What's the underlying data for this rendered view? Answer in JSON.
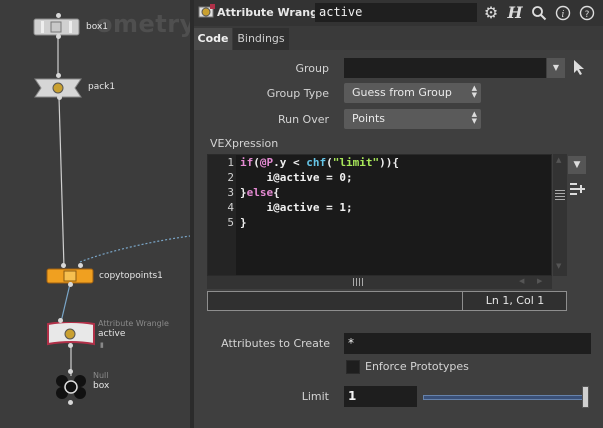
{
  "network": {
    "watermark": "ometry",
    "nodes": [
      {
        "name": "box1",
        "type": ""
      },
      {
        "name": "pack1",
        "type": ""
      },
      {
        "name": "copytopoints1",
        "type": ""
      },
      {
        "name": "active",
        "type": "Attribute Wrangle"
      },
      {
        "name": "box",
        "type": "Null"
      }
    ]
  },
  "header": {
    "node_type": "Attribute Wrangle",
    "node_name": "active",
    "icons": [
      "gear-icon",
      "help-h-icon",
      "search-icon",
      "info-icon",
      "help-icon"
    ]
  },
  "tabs": [
    {
      "label": "Code",
      "active": true
    },
    {
      "label": "Bindings",
      "active": false
    }
  ],
  "params": {
    "group_label": "Group",
    "group_value": "",
    "group_type_label": "Group Type",
    "group_type_value": "Guess from Group",
    "run_over_label": "Run Over",
    "run_over_value": "Points",
    "vexpression_label": "VEXpression",
    "code_lines": [
      {
        "no": "1",
        "text": "if(@P.y < chf(\"limit\")){"
      },
      {
        "no": "2",
        "text": "    i@active = 0;"
      },
      {
        "no": "3",
        "text": "}else{"
      },
      {
        "no": "4",
        "text": "    i@active = 1;"
      },
      {
        "no": "5",
        "text": "}"
      }
    ],
    "cursor_pos": "Ln 1, Col 1",
    "attributes_to_create_label": "Attributes to Create",
    "attributes_to_create_value": "*",
    "enforce_prototypes_label": "Enforce Prototypes",
    "enforce_prototypes_checked": false,
    "limit_label": "Limit",
    "limit_value": "1",
    "limit_slider_fraction": 1.0
  },
  "colors": {
    "accent": "#6682aa",
    "copy_node": "#f0a020",
    "wrangle_node": "#b03048"
  }
}
